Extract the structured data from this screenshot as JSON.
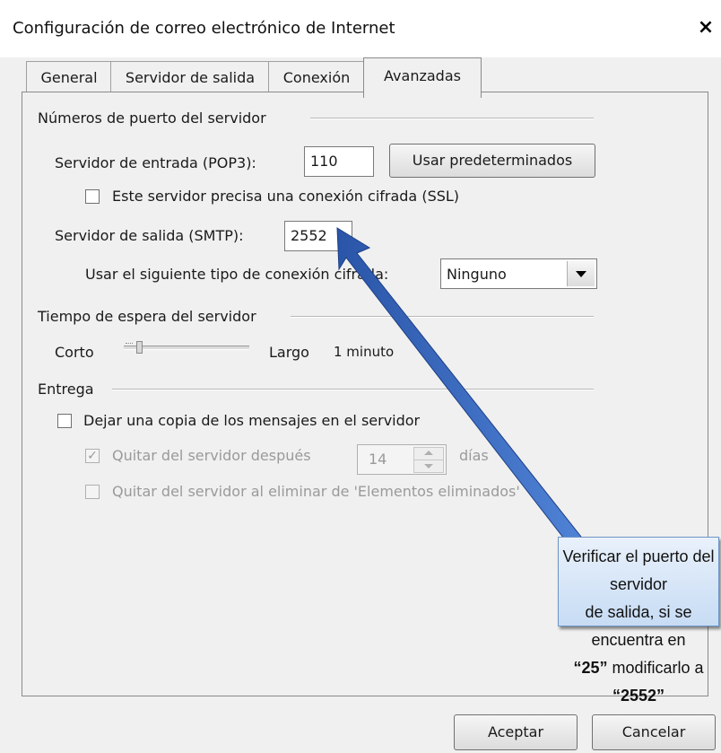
{
  "window": {
    "title": "Configuración de correo electrónico de Internet",
    "close_label": "×"
  },
  "tabs": [
    {
      "label": "General"
    },
    {
      "label": "Servidor de salida"
    },
    {
      "label": "Conexión"
    },
    {
      "label": "Avanzadas",
      "active": true
    }
  ],
  "ports": {
    "group_label": "Números de puerto del servidor",
    "incoming_label": "Servidor de entrada (POP3):",
    "incoming_value": "110",
    "defaults_button": "Usar predeterminados",
    "ssl_label": "Este servidor precisa una conexión cifrada (SSL)",
    "ssl_checked": false,
    "outgoing_label": "Servidor de salida (SMTP):",
    "outgoing_value": "2552",
    "encryption_label": "Usar el siguiente tipo de conexión cifrada:",
    "encryption_value": "Ninguno"
  },
  "timeout": {
    "group_label": "Tiempo de espera del servidor",
    "short_label": "Corto",
    "long_label": "Largo",
    "value": "1 minuto",
    "slider_fraction": 0.1
  },
  "delivery": {
    "group_label": "Entrega",
    "leave_copy_label": "Dejar una copia de los mensajes en el servidor",
    "leave_copy_checked": false,
    "remove_after_label": "Quitar del servidor después",
    "remove_after_checked": true,
    "days_value": "14",
    "days_label": "días",
    "remove_deleted_label": "Quitar del servidor al eliminar de 'Elementos eliminados'",
    "remove_deleted_checked": false
  },
  "callout": {
    "line1": "Verificar el puerto del servidor",
    "line2": "de salida, si se encuentra en",
    "value_old": "“25”",
    "middle": "modificarlo a",
    "value_new": "“2552”"
  },
  "footer": {
    "ok_button": "Aceptar",
    "cancel_button": "Cancelar"
  },
  "colors": {
    "arrow": "#2f5fb3",
    "callout_border": "#6f95c7"
  }
}
